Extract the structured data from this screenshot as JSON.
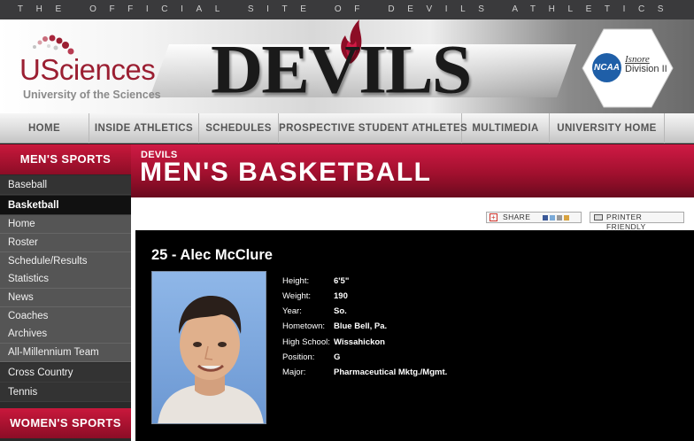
{
  "top_strip": {
    "text": "THE OFFICIAL SITE OF DEVILS ATHLETICS"
  },
  "header": {
    "logo_word": "USciences",
    "logo_subtitle": "University of the Sciences",
    "site_title": "DEVILS",
    "ncaa_label": "NCAA",
    "division_signature": "Isnore",
    "division_label": "Division II"
  },
  "nav": {
    "items": [
      "HOME",
      "INSIDE ATHLETICS",
      "SCHEDULES",
      "PROSPECTIVE STUDENT ATHLETES",
      "MULTIMEDIA",
      "UNIVERSITY HOME"
    ]
  },
  "sidebar": {
    "mens_header": "MEN'S SPORTS",
    "mens_items": [
      "Baseball",
      "Basketball"
    ],
    "basketball_sub": [
      "Home",
      "Roster",
      "Schedule/Results",
      "Statistics",
      "News",
      "Coaches",
      "Archives",
      "All-Millennium Team"
    ],
    "more_items": [
      "Cross Country",
      "Tennis"
    ],
    "womens_header": "WOMEN'S SPORTS"
  },
  "banner": {
    "small": "DEVILS",
    "title": "MEN'S BASKETBALL"
  },
  "toolbar": {
    "share_label": "SHARE",
    "printer_label": "PRINTER FRIENDLY"
  },
  "player": {
    "name": "25 - Alec McClure",
    "fields": [
      {
        "label": "Height:",
        "value": "6'5\""
      },
      {
        "label": "Weight:",
        "value": "190"
      },
      {
        "label": "Year:",
        "value": "So."
      },
      {
        "label": "Hometown:",
        "value": "Blue Bell, Pa."
      },
      {
        "label": "High School:",
        "value": "Wissahickon"
      },
      {
        "label": "Position:",
        "value": "G"
      },
      {
        "label": "Major:",
        "value": "Pharmaceutical Mktg./Mgmt."
      }
    ]
  },
  "colors": {
    "brand_red": "#b3123a",
    "nav_text": "#555555",
    "sidebar_bg": "#2a2a2a"
  }
}
